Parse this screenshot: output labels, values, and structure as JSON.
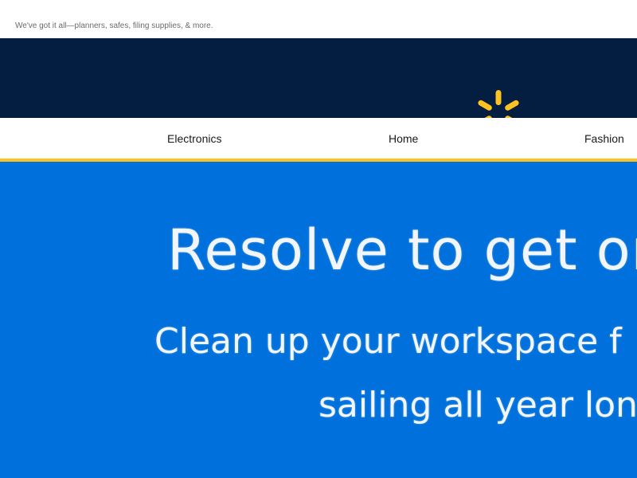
{
  "preheader": {
    "text": "We've got it all—planners, safes, filing supplies, & more."
  },
  "brand": {
    "logo_icon": "spark-icon",
    "background_color": "#041e42",
    "logo_color": "#ffc220"
  },
  "nav": {
    "items": [
      {
        "label": "Electronics"
      },
      {
        "label": "Home"
      },
      {
        "label": "Fashion"
      }
    ],
    "accent_color": "#ffc220"
  },
  "hero": {
    "background_color": "#0071dc",
    "heading": "Resolve to get org",
    "subline_1": "Clean up your workspace f",
    "subline_2": "sailing all year lon"
  }
}
